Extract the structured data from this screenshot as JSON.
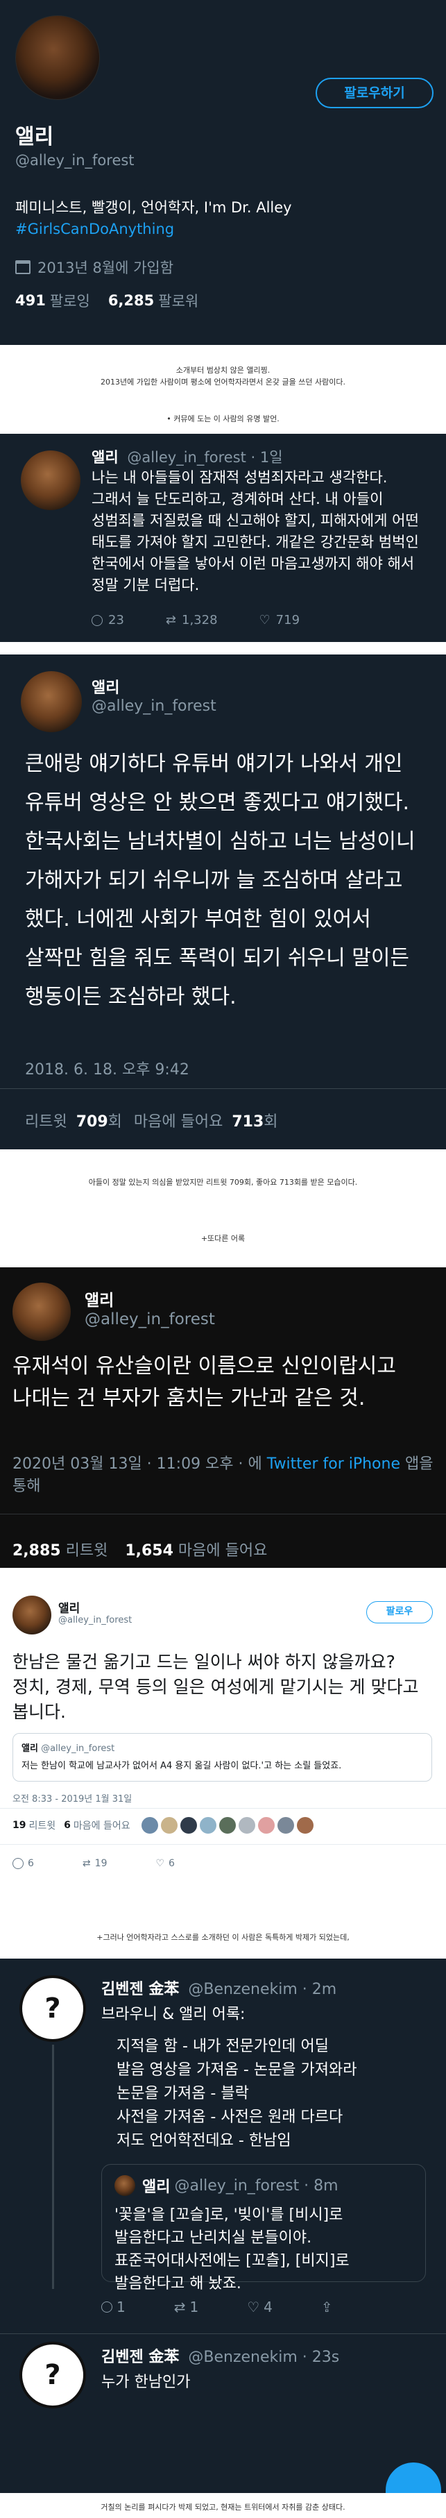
{
  "profile": {
    "follow_label": "팔로우하기",
    "name": "앨리",
    "handle": "@alley_in_forest",
    "bio": "페미니스트, 빨갱이, 언어학자, I'm Dr. Alley",
    "hashtag": "#GirlsCanDoAnything",
    "joined": "2013년 8월에 가입함",
    "following_count": "491",
    "following_label": "팔로잉",
    "followers_count": "6,285",
    "followers_label": "팔로워"
  },
  "caption1": {
    "line1": "소개부터 범상치 않은 앨리찡.",
    "line2": "2013년에 가입한 사람이며 평소에 언어학자라면서 온갖 글을 쓰던 사람이다."
  },
  "caption2": "• 커뮤에 도는 이 사람의 유명 발언.",
  "tweet1": {
    "name": "앨리",
    "meta": "@alley_in_forest · 1일",
    "text": "나는 내 아들들이 잠재적 성범죄자라고 생각한다. 그래서 늘 단도리하고, 경계하며 산다. 내 아들이 성범죄를 저질렀을 때 신고해야 할지, 피해자에게 어떤 태도를 가져야 할지 고민한다. 개같은 강간문화 범벅인 한국에서 아들을 낳아서 이런 마음고생까지 해야 해서 정말 기분 더럽다.",
    "replies": "23",
    "retweets": "1,328",
    "likes": "719"
  },
  "tweet2": {
    "name": "앨리",
    "handle": "@alley_in_forest",
    "text": "큰애랑 얘기하다 유튜버 얘기가 나와서 개인 유튜버 영상은 안 봤으면 좋겠다고 얘기했다. 한국사회는 남녀차별이 심하고 너는 남성이니 가해자가 되기 쉬우니까 늘 조심하며 살라고 했다. 너에겐 사회가 부여한 힘이 있어서 살짝만 힘을 줘도 폭력이 되기 쉬우니 말이든 행동이든 조심하라 했다.",
    "time": "2018. 6. 18. 오후 9:42",
    "retweet_label": "리트윗",
    "retweet_count": "709",
    "retweet_unit": "회",
    "like_label": "마음에 들어요",
    "like_count": "713",
    "like_unit": "회"
  },
  "caption3": "아들이 정말 있는지 의심을 받았지만 리트윗 709회, 좋아요 713회를 받은 모습이다.",
  "caption4": "+또다른 어록",
  "tweet3": {
    "name": "앨리",
    "handle": "@alley_in_forest",
    "text": "유재석이 유산슬이란 이름으로 신인이랍시고 나대는 건 부자가 훔치는 가난과 같은 것.",
    "time": "2020년 03월 13일 · 11:09 오후 · 에",
    "source": "Twitter for iPhone",
    "via": "앱을 통해",
    "retweet_count": "2,885",
    "retweet_label": "리트윗",
    "like_count": "1,654",
    "like_label": "마음에 들어요"
  },
  "tweet4": {
    "name": "앨리",
    "handle": "@alley_in_forest",
    "follow_label": "팔로우",
    "text": "한남은 물건 옮기고 드는 일이나 써야 하지 않을까요? 정치, 경제, 무역 등의 일은 여성에게 맡기시는 게 맞다고 봅니다.",
    "quote_name": "앨리",
    "quote_handle": "@alley_in_forest",
    "quote_text": "저는 한남이 학교에 남교사가 없어서 A4 용지 옮길 사람이 없다.'고 하는 소릴 들었죠.",
    "time": "오전 8:33 - 2019년 1월 31일",
    "retweets": "19",
    "retweets_label": "리트윗",
    "likes": "6",
    "likes_label": "마음에 들어요",
    "reply_count": "6",
    "rt_count": "19",
    "like_count": "6"
  },
  "caption5": "+그러나 언어학자라고 스스로를 소개하던 이 사람은 독특하게 박제가 되었는데,",
  "tweet5": {
    "name": "김벤젠 金苯",
    "meta": "@Benzenekim · 2m",
    "intro": "브라우니 & 앨리 어록:",
    "lines": [
      "지적을 함 - 내가 전문가인데 어딜",
      "발음 영상을 가져옴 - 논문을 가져와라",
      "논문을 가져옴 - 블락",
      "사전을 가져옴 - 사전은 원래 다르다",
      "저도 언어학전데요 - 한남임"
    ],
    "quote_name": "앨리",
    "quote_meta": "@alley_in_forest · 8m",
    "quote_text": "'꽃을'을 [꼬슬]로, '빚이'를 [비시]로 발음한다고 난리치실 분들이야. 표준국어대사전에는 [꼬츨], [비지]로 발음한다고 해 놨죠.",
    "q_replies": "1",
    "q_retweets": "1",
    "q_likes": "4"
  },
  "tweet6": {
    "name": "김벤젠 金苯",
    "meta": "@Benzenekim · 23s",
    "text": "누가 한남인가"
  },
  "caption6": "거칠의 논리를 펴시다가 박제 되었고, 현재는 트위터에서 자취를 감춘 상태다.",
  "colors": {
    "dark_bg": "#15202b",
    "accent": "#1da1f2",
    "muted": "#8899a6"
  }
}
